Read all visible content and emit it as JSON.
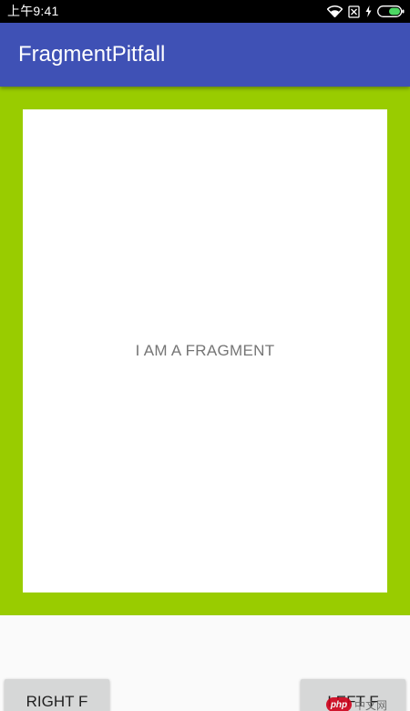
{
  "status_bar": {
    "time": "上午9:41",
    "icons": [
      "wifi-icon",
      "no-sim-icon",
      "charging-icon",
      "battery-icon"
    ],
    "background": "#000000"
  },
  "app_bar": {
    "title": "FragmentPitfall",
    "background": "#3f51b5"
  },
  "fragment": {
    "container_color": "#99cc00",
    "text": "I AM A FRAGMENT"
  },
  "buttons": {
    "right_label": "RIGHT F",
    "left_label": "LEFT F"
  },
  "watermark": {
    "logo": "php",
    "text": "中文网"
  }
}
